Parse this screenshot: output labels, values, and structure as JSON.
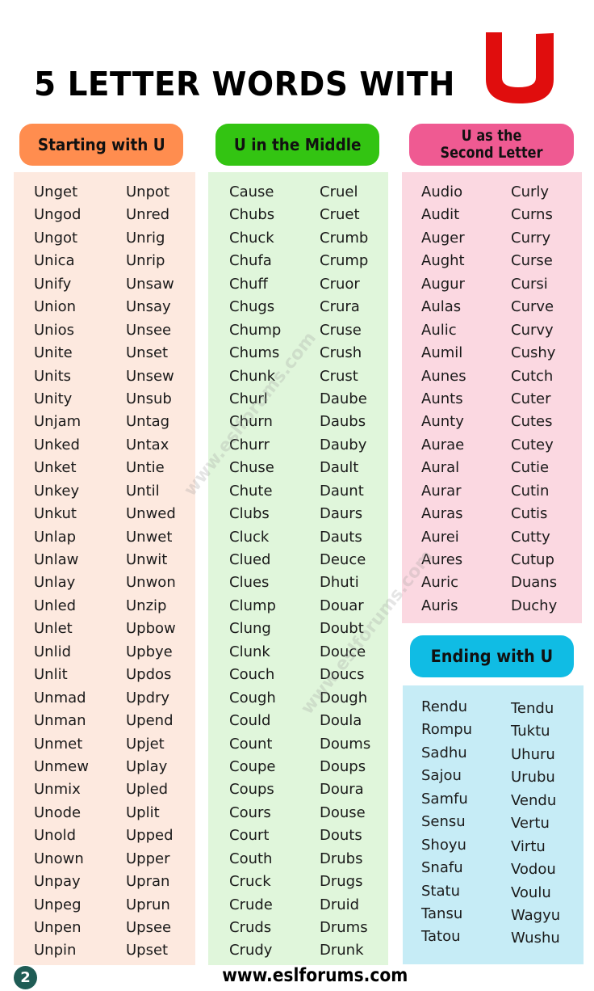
{
  "title": {
    "text": "5 LETTER WORDS WITH",
    "letter": "U",
    "letter_color": "#e00d0d"
  },
  "sections": {
    "starting": {
      "heading": "Starting with U",
      "color": "#ff8d4f",
      "panel_color": "#fde9df",
      "column1": [
        "Unget",
        "Ungod",
        "Ungot",
        "Unica",
        "Unify",
        "Union",
        "Unios",
        "Unite",
        "Units",
        "Unity",
        "Unjam",
        "Unked",
        "Unket",
        "Unkey",
        "Unkut",
        "Unlap",
        "Unlaw",
        "Unlay",
        "Unled",
        "Unlet",
        "Unlid",
        "Unlit",
        "Unmad",
        "Unman",
        "Unmet",
        "Unmew",
        "Unmix",
        "Unode",
        "Unold",
        "Unown",
        "Unpay",
        "Unpeg",
        "Unpen",
        "Unpin"
      ],
      "column2": [
        "Unpot",
        "Unred",
        "Unrig",
        "Unrip",
        "Unsaw",
        "Unsay",
        "Unsee",
        "Unset",
        "Unsew",
        "Unsub",
        "Untag",
        "Untax",
        "Untie",
        "Until",
        "Unwed",
        "Unwet",
        "Unwit",
        "Unwon",
        "Unzip",
        "Upbow",
        "Upbye",
        "Updos",
        "Updry",
        "Upend",
        "Upjet",
        "Uplay",
        "Upled",
        "Uplit",
        "Upped",
        "Upper",
        "Upran",
        "Uprun",
        "Upsee",
        "Upset"
      ]
    },
    "middle": {
      "heading": "U in the Middle",
      "color": "#33c412",
      "panel_color": "#e0f6db",
      "column1": [
        "Cause",
        "Chubs",
        "Chuck",
        "Chufa",
        "Chuff",
        "Chugs",
        "Chump",
        "Chums",
        "Chunk",
        "Churl",
        "Churn",
        "Churr",
        "Chuse",
        "Chute",
        "Clubs",
        "Cluck",
        "Clued",
        "Clues",
        "Clump",
        "Clung",
        "Clunk",
        "Couch",
        "Cough",
        "Could",
        "Count",
        "Coupe",
        "Coups",
        "Cours",
        "Court",
        "Couth",
        "Cruck",
        "Crude",
        "Cruds",
        "Crudy"
      ],
      "column2": [
        "Cruel",
        "Cruet",
        "Crumb",
        "Crump",
        "Cruor",
        "Crura",
        "Cruse",
        "Crush",
        "Crust",
        "Daube",
        "Daubs",
        "Dauby",
        "Dault",
        "Daunt",
        "Daurs",
        "Dauts",
        "Deuce",
        "Dhuti",
        "Douar",
        "Doubt",
        "Douce",
        "Doucs",
        "Dough",
        "Doula",
        "Doums",
        "Doups",
        "Doura",
        "Douse",
        "Douts",
        "Drubs",
        "Drugs",
        "Druid",
        "Drums",
        "Drunk"
      ]
    },
    "second": {
      "heading_line1": "U as the",
      "heading_line2": "Second Letter",
      "color": "#ef5a92",
      "panel_color": "#fbd8e1",
      "column1": [
        "Audio",
        "Audit",
        "Auger",
        "Aught",
        "Augur",
        "Aulas",
        "Aulic",
        "Aumil",
        "Aunes",
        "Aunts",
        "Aunty",
        "Aurae",
        "Aural",
        "Aurar",
        "Auras",
        "Aurei",
        "Aures",
        "Auric",
        "Auris"
      ],
      "column2": [
        "Curly",
        "Curns",
        "Curry",
        "Curse",
        "Cursi",
        "Curve",
        "Curvy",
        "Cushy",
        "Cutch",
        "Cuter",
        "Cutes",
        "Cutey",
        "Cutie",
        "Cutin",
        "Cutis",
        "Cutty",
        "Cutup",
        "Duans",
        "Duchy"
      ]
    },
    "ending": {
      "heading": "Ending with U",
      "color": "#10bce4",
      "panel_color": "#c6ecf6",
      "column1": [
        "Rendu",
        "Rompu",
        "Sadhu",
        "Sajou",
        "Samfu",
        "Sensu",
        "Shoyu",
        "Snafu",
        "Statu",
        "Tansu",
        "Tatou"
      ],
      "column2": [
        "Tendu",
        "Tuktu",
        "Uhuru",
        "Urubu",
        "Vendu",
        "Vertu",
        "Virtu",
        "Vodou",
        "Voulu",
        "Wagyu",
        "Wushu"
      ]
    }
  },
  "watermark": "www.eslforums.com",
  "footer": {
    "page_number": "2",
    "url": "www.eslforums.com"
  }
}
